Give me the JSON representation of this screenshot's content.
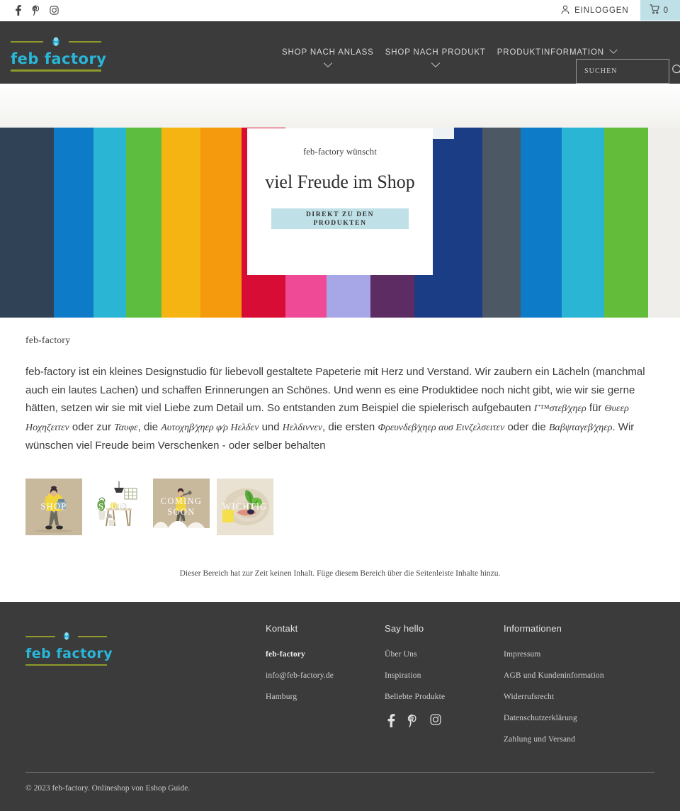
{
  "topbar": {
    "social": [
      {
        "name": "facebook-icon",
        "label": "Facebook"
      },
      {
        "name": "pinterest-icon",
        "label": "Pinterest"
      },
      {
        "name": "instagram-icon",
        "label": "Instagram"
      }
    ],
    "login_label": "EINLOGGEN",
    "cart_count": "0"
  },
  "header": {
    "logo_text": "feb factory",
    "nav": [
      {
        "label": "SHOP NACH ANLASS",
        "caret": "below"
      },
      {
        "label": "SHOP NACH PRODUKT",
        "caret": "below"
      },
      {
        "label": "PRODUKTINFORMATION",
        "caret": "inline"
      }
    ],
    "search_placeholder": "SUCHEN",
    "search_value": ""
  },
  "hero": {
    "eyebrow": "feb-factory wünscht",
    "title": "viel Freude im Shop",
    "cta_line1": "DIREKT ZU DEN",
    "cta_line2": "PRODUKTEN",
    "book_colors": [
      "#2f4256",
      "#2f4256",
      "#0e7bc8",
      "#2bb5d4",
      "#5cbd3f",
      "#f5b412",
      "#f59a0d",
      "#d80d35",
      "#ef4a96",
      "#a7a7e8",
      "#5d2c63",
      "#1b3d86",
      "#1b3d86",
      "#4c5964",
      "#0e7bc8",
      "#2bb5d4",
      "#64bd3a",
      "#f0eeea"
    ]
  },
  "main": {
    "kicker": "feb-factory",
    "paragraph_parts": [
      {
        "type": "text",
        "value": "feb-factory ist ein kleines Designstudio für liebevoll gestaltete Papeterie mit Herz und Verstand. Wir zaubern ein Lächeln (manchmal auch ein lautes Lachen) und schaffen Erinnerungen an Schönes. Und wenn es eine Produktidee noch nicht gibt, wie wir sie gerne hätten, setzen wir sie mit viel Liebe zum Detail um. So entstanden zum Beispiel die spielerisch aufgebauten "
      },
      {
        "type": "sym",
        "value": "Γ™στεβ⁄χηερ"
      },
      {
        "type": "text",
        "value": " für "
      },
      {
        "type": "sym",
        "value": "Θυεερ Ηοχηζειτεν"
      },
      {
        "type": "text",
        "value": " oder zur "
      },
      {
        "type": "sym",
        "value": "Ταυφε"
      },
      {
        "type": "text",
        "value": ", die "
      },
      {
        "type": "sym",
        "value": "Αυτοχηβ⁄χηερ φ⁄ρ Ηελδεν"
      },
      {
        "type": "text",
        "value": " und "
      },
      {
        "type": "sym",
        "value": "Ηελδιννεν"
      },
      {
        "type": "text",
        "value": ", die ersten "
      },
      {
        "type": "sym",
        "value": "Φρευνδεβ⁄χηερ αυσ Εινζελσειτεν"
      },
      {
        "type": "text",
        "value": " oder die "
      },
      {
        "type": "sym",
        "value": "Βαβψταγεβ⁄χηερ"
      },
      {
        "type": "text",
        "value": ". Wir wünschen viel Freude beim Verschenken - oder selber behalten"
      }
    ],
    "tiles": [
      {
        "label": "SHOP",
        "name": "tile-shop",
        "bg": "#c9b99c"
      },
      {
        "label": "STUDIO",
        "name": "tile-studio",
        "bg": "#ffffff"
      },
      {
        "label": "COMING SOON",
        "name": "tile-coming-soon",
        "bg": "#c9b99c"
      },
      {
        "label": "WICHTIG",
        "name": "tile-wichtig",
        "bg": "#e9e2d2"
      }
    ],
    "empty_notice": "Dieser Bereich hat zur Zeit keinen Inhalt. Füge diesem Bereich über die Seitenleiste Inhalte hinzu."
  },
  "footer": {
    "logo_text": "feb factory",
    "columns": [
      {
        "heading": "Kontakt",
        "items": [
          {
            "label": "feb-factory",
            "bold": true,
            "interactable": false
          },
          {
            "label": "info@feb-factory.de",
            "bold": false,
            "interactable": false
          },
          {
            "label": "Hamburg",
            "bold": false,
            "interactable": false
          }
        ]
      },
      {
        "heading": "Say hello",
        "items": [
          {
            "label": "Über Uns",
            "bold": false,
            "interactable": true
          },
          {
            "label": "Inspiration",
            "bold": false,
            "interactable": true
          },
          {
            "label": "Beliebte Produkte",
            "bold": false,
            "interactable": true
          }
        ]
      },
      {
        "heading": "Informationen",
        "items": [
          {
            "label": "Impressum",
            "bold": false,
            "interactable": true
          },
          {
            "label": "AGB und Kundeninformation",
            "bold": false,
            "interactable": true
          },
          {
            "label": "Widerrufsrecht",
            "bold": false,
            "interactable": true
          },
          {
            "label": "Datenschutzerklärung",
            "bold": false,
            "interactable": true
          },
          {
            "label": "Zahlung und Versand",
            "bold": false,
            "interactable": true
          }
        ]
      }
    ],
    "social": [
      {
        "name": "facebook-icon",
        "label": "Facebook"
      },
      {
        "name": "pinterest-icon",
        "label": "Pinterest"
      },
      {
        "name": "instagram-icon",
        "label": "Instagram"
      }
    ],
    "copyright": "© 2023 feb-factory. Onlineshop von Eshop Guide."
  },
  "colors": {
    "header_bg": "#3b3b3b",
    "accent_cyan": "#29b6d8",
    "accent_olive": "#8f9a2a",
    "accent_light_blue": "#bfe0e6"
  }
}
